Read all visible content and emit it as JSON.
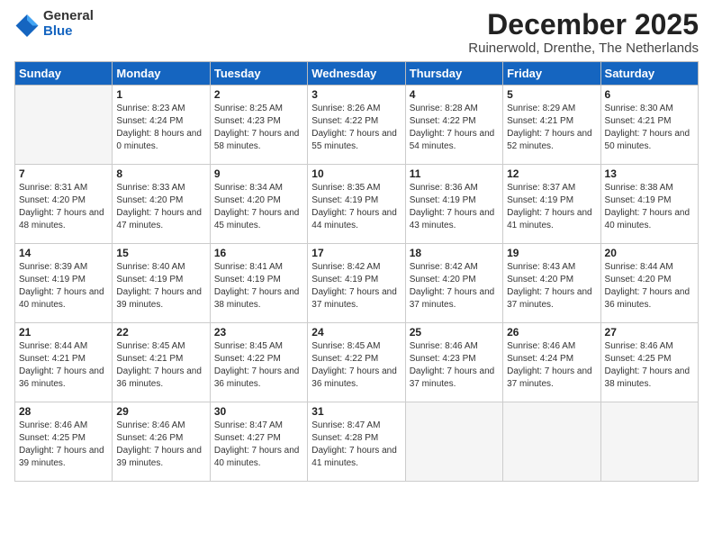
{
  "logo": {
    "general": "General",
    "blue": "Blue"
  },
  "title": "December 2025",
  "location": "Ruinerwold, Drenthe, The Netherlands",
  "header": {
    "days": [
      "Sunday",
      "Monday",
      "Tuesday",
      "Wednesday",
      "Thursday",
      "Friday",
      "Saturday"
    ]
  },
  "weeks": [
    [
      {
        "day": "",
        "empty": true
      },
      {
        "day": "1",
        "sunrise": "Sunrise: 8:23 AM",
        "sunset": "Sunset: 4:24 PM",
        "daylight": "Daylight: 8 hours and 0 minutes."
      },
      {
        "day": "2",
        "sunrise": "Sunrise: 8:25 AM",
        "sunset": "Sunset: 4:23 PM",
        "daylight": "Daylight: 7 hours and 58 minutes."
      },
      {
        "day": "3",
        "sunrise": "Sunrise: 8:26 AM",
        "sunset": "Sunset: 4:22 PM",
        "daylight": "Daylight: 7 hours and 55 minutes."
      },
      {
        "day": "4",
        "sunrise": "Sunrise: 8:28 AM",
        "sunset": "Sunset: 4:22 PM",
        "daylight": "Daylight: 7 hours and 54 minutes."
      },
      {
        "day": "5",
        "sunrise": "Sunrise: 8:29 AM",
        "sunset": "Sunset: 4:21 PM",
        "daylight": "Daylight: 7 hours and 52 minutes."
      },
      {
        "day": "6",
        "sunrise": "Sunrise: 8:30 AM",
        "sunset": "Sunset: 4:21 PM",
        "daylight": "Daylight: 7 hours and 50 minutes."
      }
    ],
    [
      {
        "day": "7",
        "sunrise": "Sunrise: 8:31 AM",
        "sunset": "Sunset: 4:20 PM",
        "daylight": "Daylight: 7 hours and 48 minutes."
      },
      {
        "day": "8",
        "sunrise": "Sunrise: 8:33 AM",
        "sunset": "Sunset: 4:20 PM",
        "daylight": "Daylight: 7 hours and 47 minutes."
      },
      {
        "day": "9",
        "sunrise": "Sunrise: 8:34 AM",
        "sunset": "Sunset: 4:20 PM",
        "daylight": "Daylight: 7 hours and 45 minutes."
      },
      {
        "day": "10",
        "sunrise": "Sunrise: 8:35 AM",
        "sunset": "Sunset: 4:19 PM",
        "daylight": "Daylight: 7 hours and 44 minutes."
      },
      {
        "day": "11",
        "sunrise": "Sunrise: 8:36 AM",
        "sunset": "Sunset: 4:19 PM",
        "daylight": "Daylight: 7 hours and 43 minutes."
      },
      {
        "day": "12",
        "sunrise": "Sunrise: 8:37 AM",
        "sunset": "Sunset: 4:19 PM",
        "daylight": "Daylight: 7 hours and 41 minutes."
      },
      {
        "day": "13",
        "sunrise": "Sunrise: 8:38 AM",
        "sunset": "Sunset: 4:19 PM",
        "daylight": "Daylight: 7 hours and 40 minutes."
      }
    ],
    [
      {
        "day": "14",
        "sunrise": "Sunrise: 8:39 AM",
        "sunset": "Sunset: 4:19 PM",
        "daylight": "Daylight: 7 hours and 40 minutes."
      },
      {
        "day": "15",
        "sunrise": "Sunrise: 8:40 AM",
        "sunset": "Sunset: 4:19 PM",
        "daylight": "Daylight: 7 hours and 39 minutes."
      },
      {
        "day": "16",
        "sunrise": "Sunrise: 8:41 AM",
        "sunset": "Sunset: 4:19 PM",
        "daylight": "Daylight: 7 hours and 38 minutes."
      },
      {
        "day": "17",
        "sunrise": "Sunrise: 8:42 AM",
        "sunset": "Sunset: 4:19 PM",
        "daylight": "Daylight: 7 hours and 37 minutes."
      },
      {
        "day": "18",
        "sunrise": "Sunrise: 8:42 AM",
        "sunset": "Sunset: 4:20 PM",
        "daylight": "Daylight: 7 hours and 37 minutes."
      },
      {
        "day": "19",
        "sunrise": "Sunrise: 8:43 AM",
        "sunset": "Sunset: 4:20 PM",
        "daylight": "Daylight: 7 hours and 37 minutes."
      },
      {
        "day": "20",
        "sunrise": "Sunrise: 8:44 AM",
        "sunset": "Sunset: 4:20 PM",
        "daylight": "Daylight: 7 hours and 36 minutes."
      }
    ],
    [
      {
        "day": "21",
        "sunrise": "Sunrise: 8:44 AM",
        "sunset": "Sunset: 4:21 PM",
        "daylight": "Daylight: 7 hours and 36 minutes."
      },
      {
        "day": "22",
        "sunrise": "Sunrise: 8:45 AM",
        "sunset": "Sunset: 4:21 PM",
        "daylight": "Daylight: 7 hours and 36 minutes."
      },
      {
        "day": "23",
        "sunrise": "Sunrise: 8:45 AM",
        "sunset": "Sunset: 4:22 PM",
        "daylight": "Daylight: 7 hours and 36 minutes."
      },
      {
        "day": "24",
        "sunrise": "Sunrise: 8:45 AM",
        "sunset": "Sunset: 4:22 PM",
        "daylight": "Daylight: 7 hours and 36 minutes."
      },
      {
        "day": "25",
        "sunrise": "Sunrise: 8:46 AM",
        "sunset": "Sunset: 4:23 PM",
        "daylight": "Daylight: 7 hours and 37 minutes."
      },
      {
        "day": "26",
        "sunrise": "Sunrise: 8:46 AM",
        "sunset": "Sunset: 4:24 PM",
        "daylight": "Daylight: 7 hours and 37 minutes."
      },
      {
        "day": "27",
        "sunrise": "Sunrise: 8:46 AM",
        "sunset": "Sunset: 4:25 PM",
        "daylight": "Daylight: 7 hours and 38 minutes."
      }
    ],
    [
      {
        "day": "28",
        "sunrise": "Sunrise: 8:46 AM",
        "sunset": "Sunset: 4:25 PM",
        "daylight": "Daylight: 7 hours and 39 minutes."
      },
      {
        "day": "29",
        "sunrise": "Sunrise: 8:46 AM",
        "sunset": "Sunset: 4:26 PM",
        "daylight": "Daylight: 7 hours and 39 minutes."
      },
      {
        "day": "30",
        "sunrise": "Sunrise: 8:47 AM",
        "sunset": "Sunset: 4:27 PM",
        "daylight": "Daylight: 7 hours and 40 minutes."
      },
      {
        "day": "31",
        "sunrise": "Sunrise: 8:47 AM",
        "sunset": "Sunset: 4:28 PM",
        "daylight": "Daylight: 7 hours and 41 minutes."
      },
      {
        "day": "",
        "empty": true
      },
      {
        "day": "",
        "empty": true
      },
      {
        "day": "",
        "empty": true
      }
    ]
  ]
}
